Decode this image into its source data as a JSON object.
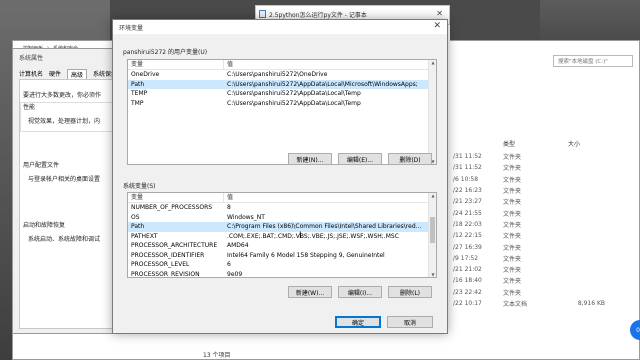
{
  "notepad": {
    "title": "2.5python怎么运行py文件 - 记事本"
  },
  "explorer": {
    "breadcrumbs": [
      "控制面板",
      "系统和安全"
    ],
    "search_placeholder": "搜索\"本地磁盘 (C:)\"",
    "column_type": "类型",
    "column_size": "大小",
    "rows": [
      {
        "date": "/31 11:52",
        "type": "文件夹",
        "size": ""
      },
      {
        "date": "/31 11:52",
        "type": "文件夹",
        "size": ""
      },
      {
        "date": "/6 10:58",
        "type": "文件夹",
        "size": ""
      },
      {
        "date": "/22 16:23",
        "type": "文件夹",
        "size": ""
      },
      {
        "date": "/21 23:27",
        "type": "文件夹",
        "size": ""
      },
      {
        "date": "/24 21:55",
        "type": "文件夹",
        "size": ""
      },
      {
        "date": "/18 22:03",
        "type": "文件夹",
        "size": ""
      },
      {
        "date": "/12 22:15",
        "type": "文件夹",
        "size": ""
      },
      {
        "date": "/27 16:39",
        "type": "文件夹",
        "size": ""
      },
      {
        "date": "/9 17:52",
        "type": "文件夹",
        "size": ""
      },
      {
        "date": "/21 21:02",
        "type": "文件夹",
        "size": ""
      },
      {
        "date": "/16 18:40",
        "type": "文件夹",
        "size": ""
      },
      {
        "date": "/23 22:42",
        "type": "文件夹",
        "size": ""
      },
      {
        "date": "/22 10:17",
        "type": "文本文档",
        "size": "8,916 KB"
      }
    ],
    "count": "13 个项目"
  },
  "sysprops": {
    "title": "系统属性",
    "tabs": [
      "计算机名",
      "硬件",
      "高级",
      "系统保护"
    ],
    "active_tab": "高级",
    "intro": "要进行大多数更改，你必须作",
    "perf_label": "性能",
    "perf_text": "视觉效果，处理器计划，内",
    "profile_label": "用户配置文件",
    "profile_text": "与登录帐户相关的桌面设置",
    "startup_label": "启动和故障恢复",
    "startup_text": "系统启动、系统故障和调试"
  },
  "dialog": {
    "title": "环境变量",
    "user_section": "panshirui5272 的用户变量(U)",
    "user_header": {
      "var": "变量",
      "val": "值"
    },
    "user_vars": [
      {
        "name": "OneDrive",
        "value": "C:\\Users\\panshirui5272\\OneDrive"
      },
      {
        "name": "Path",
        "value": "C:\\Users\\panshirui5272\\AppData\\Local\\Microsoft\\WindowsApps;"
      },
      {
        "name": "TEMP",
        "value": "C:\\Users\\panshirui5272\\AppData\\Local\\Temp"
      },
      {
        "name": "TMP",
        "value": "C:\\Users\\panshirui5272\\AppData\\Local\\Temp"
      }
    ],
    "user_selected_index": 1,
    "user_buttons": {
      "new": "新建(N)...",
      "edit": "编辑(E)...",
      "delete": "删除(D)"
    },
    "sys_section": "系统变量(S)",
    "sys_header": {
      "var": "变量",
      "val": "值"
    },
    "sys_vars": [
      {
        "name": "NUMBER_OF_PROCESSORS",
        "value": "8"
      },
      {
        "name": "OS",
        "value": "Windows_NT"
      },
      {
        "name": "Path",
        "value": "C:\\Program Files (x86)\\Common Files\\Intel\\Shared Libraries\\red..."
      },
      {
        "name": "PATHEXT",
        "value": ".COM;.EXE;.BAT;.CMD;.VBS;.VBE;.JS;.JSE;.WSF;.WSH;.MSC"
      },
      {
        "name": "PROCESSOR_ARCHITECTURE",
        "value": "AMD64"
      },
      {
        "name": "PROCESSOR_IDENTIFIER",
        "value": "Intel64 Family 6 Model 158 Stepping 9, GenuineIntel"
      },
      {
        "name": "PROCESSOR_LEVEL",
        "value": "6"
      },
      {
        "name": "PROCESSOR_REVISION",
        "value": "9e09"
      }
    ],
    "sys_selected_index": 2,
    "sys_buttons": {
      "new": "新建(W)...",
      "edit": "编辑(I)...",
      "delete": "删除(L)"
    },
    "ok": "确定",
    "cancel": "取消"
  },
  "badge": "00"
}
